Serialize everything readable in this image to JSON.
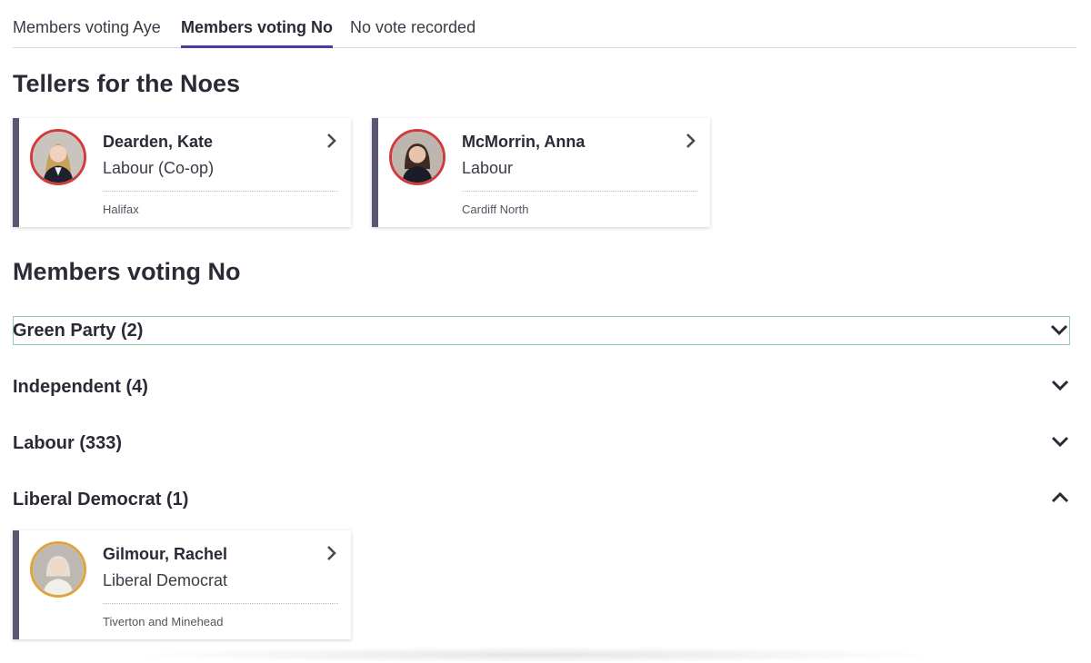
{
  "tabs": [
    {
      "label": "Members voting Aye",
      "active": false
    },
    {
      "label": "Members voting No",
      "active": true
    },
    {
      "label": "No vote recorded",
      "active": false
    }
  ],
  "tellers": {
    "title": "Tellers for the Noes",
    "members": [
      {
        "name": "Dearden, Kate",
        "party": "Labour (Co-op)",
        "constituency": "Halifax"
      },
      {
        "name": "McMorrin, Anna",
        "party": "Labour",
        "constituency": "Cardiff North"
      }
    ]
  },
  "voting": {
    "title": "Members voting No",
    "groups": [
      {
        "label": "Green Party (2)",
        "expanded": false
      },
      {
        "label": "Independent (4)",
        "expanded": false
      },
      {
        "label": "Labour (333)",
        "expanded": false
      },
      {
        "label": "Liberal Democrat (1)",
        "expanded": true
      }
    ],
    "libdem_members": [
      {
        "name": "Gilmour, Rachel",
        "party": "Liberal Democrat",
        "constituency": "Tiverton and Minehead"
      }
    ]
  },
  "colors": {
    "accent": "#4d3c9b",
    "card_bar": "#5c5673",
    "labour": "#d03b3b",
    "libdem": "#e0a340",
    "focus": "#8fcfb5"
  }
}
